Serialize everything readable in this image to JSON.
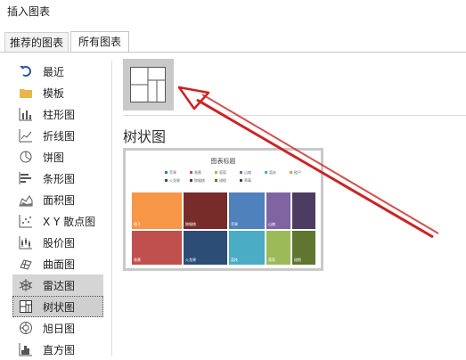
{
  "window": {
    "title": "插入图表"
  },
  "tabs": [
    {
      "label": "推荐的图表"
    },
    {
      "label": "所有图表"
    }
  ],
  "sidebar": {
    "items": [
      {
        "label": "最近",
        "icon": "undo-icon"
      },
      {
        "label": "模板",
        "icon": "folder-icon"
      },
      {
        "label": "柱形图",
        "icon": "column-chart-icon"
      },
      {
        "label": "折线图",
        "icon": "line-chart-icon"
      },
      {
        "label": "饼图",
        "icon": "pie-chart-icon"
      },
      {
        "label": "条形图",
        "icon": "bar-chart-icon"
      },
      {
        "label": "面积图",
        "icon": "area-chart-icon"
      },
      {
        "label": "X Y 散点图",
        "icon": "scatter-chart-icon"
      },
      {
        "label": "股价图",
        "icon": "stock-chart-icon"
      },
      {
        "label": "曲面图",
        "icon": "surface-chart-icon"
      },
      {
        "label": "雷达图",
        "icon": "radar-chart-icon"
      },
      {
        "label": "树状图",
        "icon": "treemap-chart-icon"
      },
      {
        "label": "旭日图",
        "icon": "sunburst-chart-icon"
      },
      {
        "label": "直方图",
        "icon": "histogram-chart-icon"
      }
    ],
    "highlighted_index": 10,
    "selected_index": 11
  },
  "main": {
    "section_title": "树状图",
    "preview": {
      "chart_title": "图表标题",
      "legend": [
        {
          "label": "苹果",
          "color": "#4472c4"
        },
        {
          "label": "香蕉",
          "color": "#c0504d"
        },
        {
          "label": "葡萄",
          "color": "#9bbb59"
        },
        {
          "label": "山楂",
          "color": "#8064a2"
        },
        {
          "label": "荔枝",
          "color": "#4bacc6"
        },
        {
          "label": "橙子",
          "color": "#f79646"
        },
        {
          "label": "火龙果",
          "color": "#2c4d75"
        },
        {
          "label": "猕猴桃",
          "color": "#772c2a"
        },
        {
          "label": "甜橙",
          "color": "#5f7530"
        },
        {
          "label": "草莓",
          "color": "#4d3b62"
        }
      ],
      "cells": [
        {
          "label": "橙子",
          "color": "#f79646"
        },
        {
          "label": "猕猴桃",
          "color": "#772c2a"
        },
        {
          "label": "苹果",
          "color": "#4f81bd"
        },
        {
          "label": "山楂",
          "color": "#8064a2"
        },
        {
          "label": "",
          "color": "#4d3b62"
        },
        {
          "label": "香蕉",
          "color": "#c0504d"
        },
        {
          "label": "火龙果",
          "color": "#2c4d75"
        },
        {
          "label": "荔枝",
          "color": "#4bacc6"
        },
        {
          "label": "葡萄",
          "color": "#9bbb59"
        },
        {
          "label": "甜橙",
          "color": "#5f7530"
        }
      ]
    }
  },
  "colors": {
    "arrow": "#cc2222",
    "selection": "#cfcfcf"
  }
}
